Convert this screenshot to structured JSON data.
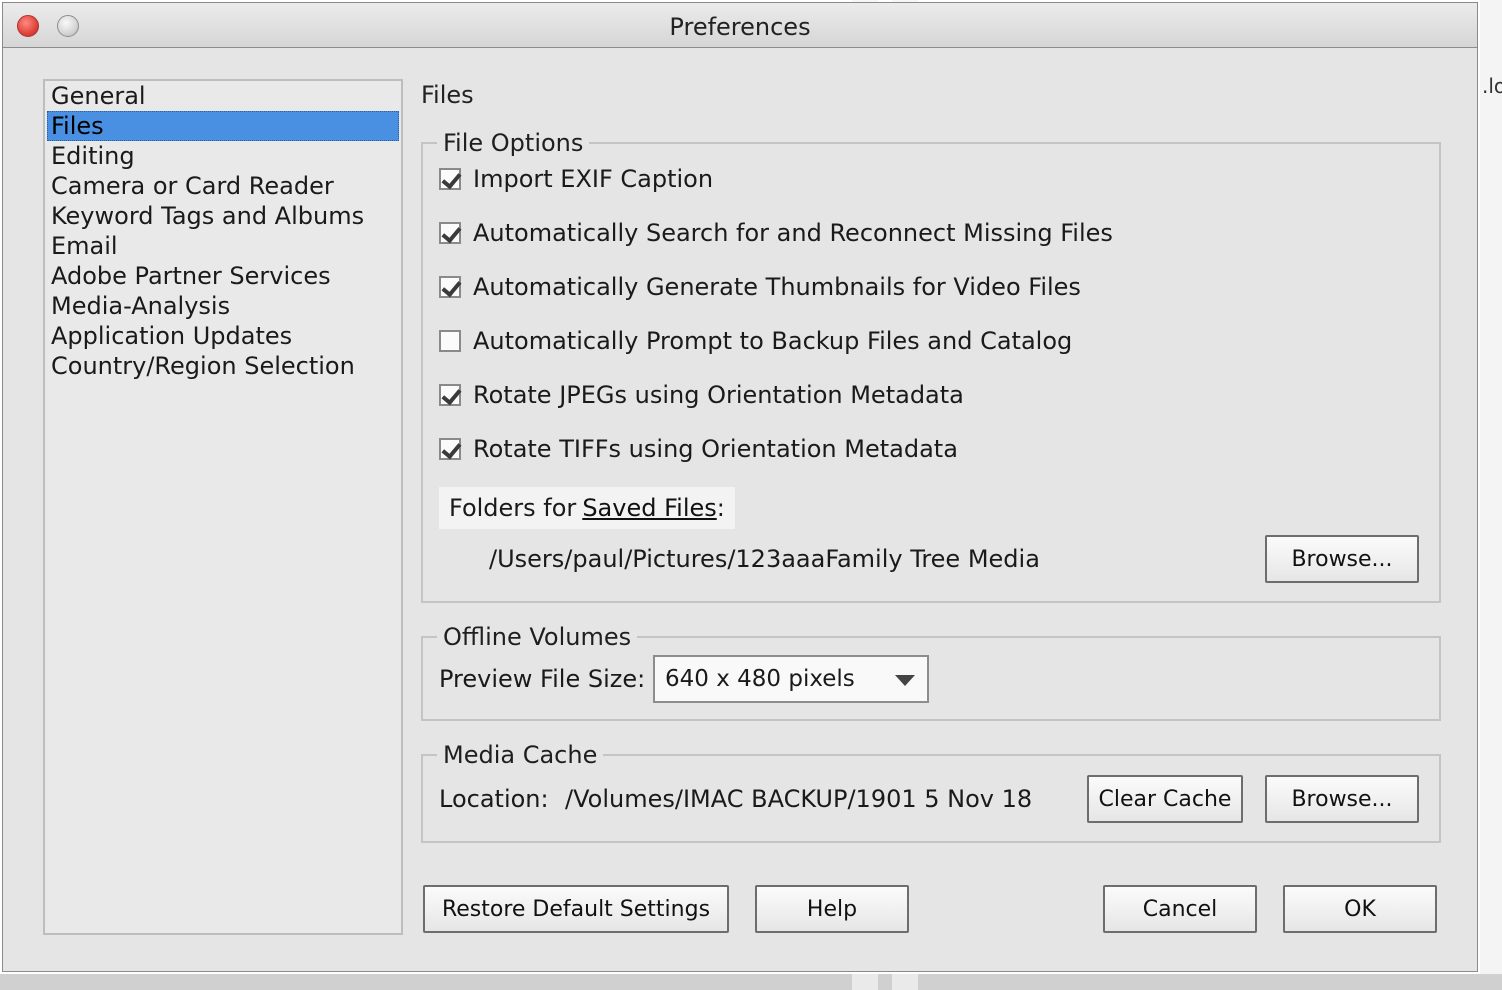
{
  "window": {
    "title": "Preferences"
  },
  "background": {
    "right_text": ".lo"
  },
  "sidebar": {
    "items": [
      {
        "label": "General"
      },
      {
        "label": "Files",
        "selected": true
      },
      {
        "label": "Editing"
      },
      {
        "label": "Camera or Card Reader"
      },
      {
        "label": "Keyword Tags and Albums"
      },
      {
        "label": "Email"
      },
      {
        "label": "Adobe Partner Services"
      },
      {
        "label": "Media-Analysis"
      },
      {
        "label": "Application Updates"
      },
      {
        "label": "Country/Region Selection"
      }
    ]
  },
  "panel": {
    "heading": "Files",
    "file_options": {
      "legend": "File Options",
      "checkboxes": [
        {
          "label": "Import EXIF Caption",
          "checked": true
        },
        {
          "label": "Automatically Search for and Reconnect Missing Files",
          "checked": true
        },
        {
          "label": "Automatically Generate Thumbnails for Video Files",
          "checked": true
        },
        {
          "label": "Automatically Prompt to Backup Files and Catalog",
          "checked": false
        },
        {
          "label": "Rotate JPEGs using Orientation Metadata",
          "checked": true
        },
        {
          "label": "Rotate TIFFs using Orientation Metadata",
          "checked": true
        }
      ],
      "folders_prefix": "Folders for",
      "folders_link": "Saved Files",
      "folders_suffix": ":",
      "saved_files_path": "/Users/paul/Pictures/123aaaFamily Tree Media",
      "browse_label": "Browse..."
    },
    "offline_volumes": {
      "legend": "Offline Volumes",
      "preview_label": "Preview File Size:",
      "preview_value": "640 x 480 pixels"
    },
    "media_cache": {
      "legend": "Media Cache",
      "location_label": "Location:",
      "location_path": "/Volumes/IMAC BACKUP/1901 5 Nov 18",
      "clear_label": "Clear Cache",
      "browse_label": "Browse..."
    }
  },
  "footer": {
    "restore_label": "Restore Default Settings",
    "help_label": "Help",
    "cancel_label": "Cancel",
    "ok_label": "OK"
  }
}
